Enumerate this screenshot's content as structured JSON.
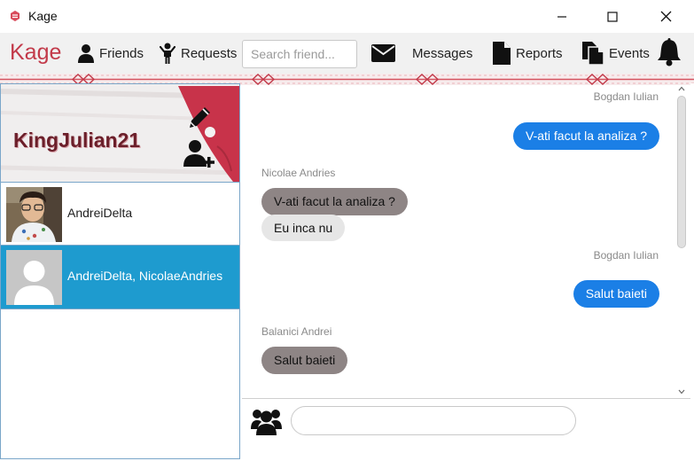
{
  "window": {
    "title": "Kage",
    "app_icon": "kage-logo-icon",
    "controls": [
      "minimize-icon",
      "maximize-icon",
      "close-icon"
    ]
  },
  "nav": {
    "brand": "Kage",
    "friends": "Friends",
    "requests": "Requests",
    "search_placeholder": "Search friend...",
    "messages": "Messages",
    "reports": "Reports",
    "events": "Events",
    "icons": {
      "friends": "person-icon",
      "requests": "person-waving-icon",
      "messages": "envelope-icon",
      "reports": "document-icon",
      "events": "documents-icon",
      "notifications": "bell-icon"
    }
  },
  "profile": {
    "username": "KingJulian21",
    "edit_icon": "pencil-icon",
    "add_friend_icon": "add-user-icon"
  },
  "conversations": [
    {
      "name": "AndreiDelta",
      "avatar": "photo",
      "selected": false
    },
    {
      "name": "AndreiDelta, NicolaeAndries",
      "avatar": "default-avatar",
      "selected": true
    }
  ],
  "messages": [
    {
      "sender": "Bogdan Iulian",
      "text": "V-ati facut la analiza ?",
      "mine": true
    },
    {
      "sender": "Nicolae Andries",
      "text": "V-ati facut la analiza ?",
      "mine": false
    },
    {
      "sender": "",
      "text": "Eu inca nu",
      "mine": false
    },
    {
      "sender": "Bogdan Iulian",
      "text": "Salut baieti",
      "mine": true
    },
    {
      "sender": "Balanici Andrei",
      "text": "Salut baieti",
      "mine": false
    }
  ],
  "composer": {
    "icon": "group-icon",
    "placeholder": ""
  },
  "colors": {
    "brand": "#c23a4a",
    "selected": "#1e9bcf",
    "my_bubble": "#1b7fe6",
    "their_bubble": "#8e8585",
    "their_bubble_light": "#e6e6e6"
  }
}
